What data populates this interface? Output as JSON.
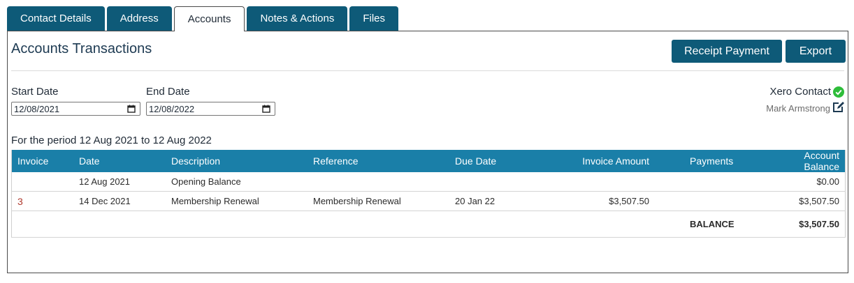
{
  "tabs": [
    {
      "label": "Contact Details"
    },
    {
      "label": "Address"
    },
    {
      "label": "Accounts",
      "active": true
    },
    {
      "label": "Notes & Actions"
    },
    {
      "label": "Files"
    }
  ],
  "header": {
    "title": "Accounts Transactions",
    "receipt_label": "Receipt Payment",
    "export_label": "Export"
  },
  "filters": {
    "start_label": "Start Date",
    "start_value": "12/08/2021",
    "end_label": "End Date",
    "end_value": "12/08/2022"
  },
  "xero": {
    "label": "Xero Contact",
    "name": "Mark Armstrong",
    "status_color": "#2ebd3a"
  },
  "period_text": "For the period 12 Aug 2021 to 12 Aug 2022",
  "table": {
    "columns": [
      "Invoice",
      "Date",
      "Description",
      "Reference",
      "Due Date",
      "Invoice Amount",
      "Payments",
      "Account Balance"
    ],
    "rows": [
      {
        "invoice": "",
        "date": "12 Aug 2021",
        "description": "Opening Balance",
        "reference": "",
        "due": "",
        "amount": "",
        "payments": "",
        "balance": "$0.00"
      },
      {
        "invoice": "3",
        "date": "14 Dec 2021",
        "description": "Membership Renewal",
        "reference": "Membership Renewal",
        "due": "20 Jan 22",
        "amount": "$3,507.50",
        "payments": "",
        "balance": "$3,507.50"
      }
    ],
    "total_label": "BALANCE",
    "total_value": "$3,507.50"
  }
}
